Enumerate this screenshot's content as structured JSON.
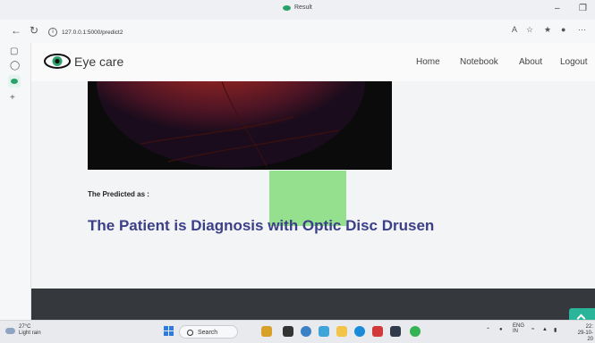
{
  "browser": {
    "tab_title": "Result",
    "url": "127.0.0.1:5000/predict2",
    "minimize": "–",
    "restore": "❐"
  },
  "site": {
    "brand": "Eye care",
    "nav": [
      "Home",
      "Notebook",
      "About",
      "Logout"
    ]
  },
  "result": {
    "label": "The Predicted as :",
    "diagnosis": "The Patient is Diagnosis with Optic Disc Drusen"
  },
  "taskbar": {
    "weather_temp": "27°C",
    "weather_desc": "Light rain",
    "search": "Search",
    "lang": "ENG",
    "lang_sub": "IN",
    "time": "22:",
    "date": "29-10-20"
  },
  "colors": {
    "brand_green": "#2aa36b",
    "diagnosis_text": "#3b3f88",
    "highlight": "#95e08f",
    "footer": "#35383d"
  }
}
